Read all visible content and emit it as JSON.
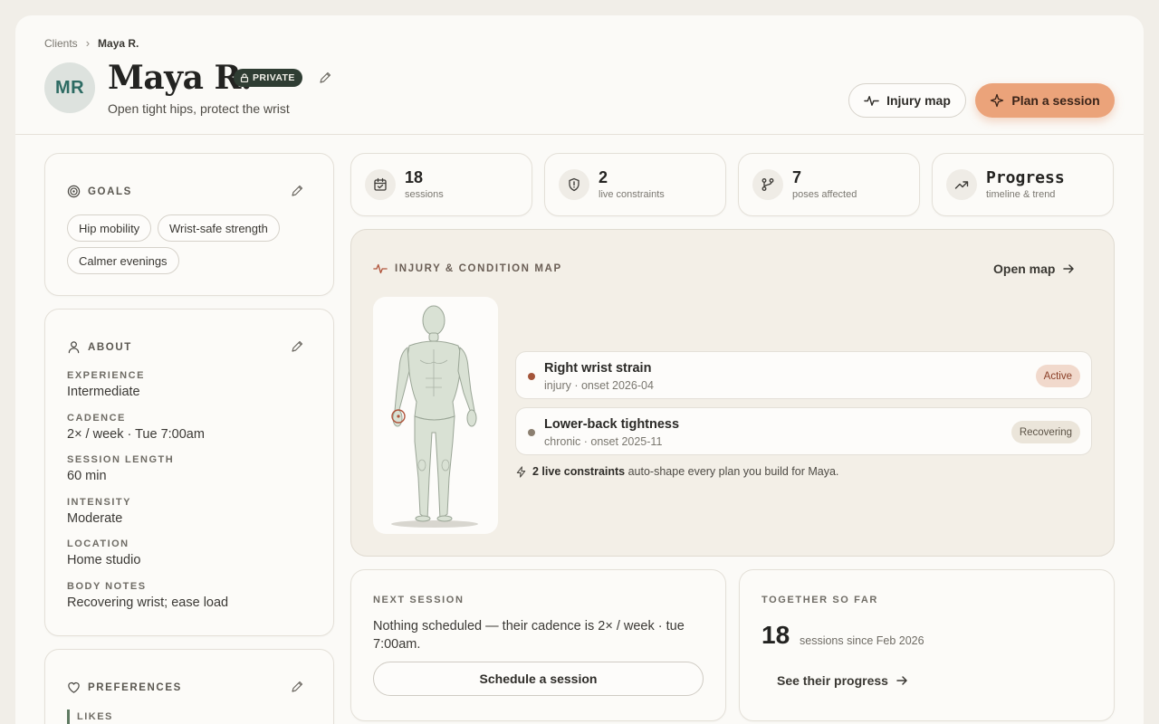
{
  "breadcrumb": {
    "root": "Clients",
    "current": "Maya R."
  },
  "client": {
    "initials": "MR",
    "name": "Maya R.",
    "privacy": "PRIVATE",
    "tagline": "Open tight hips, protect the wrist"
  },
  "header_actions": {
    "injury_map": "Injury map",
    "plan_session": "Plan a session"
  },
  "goals": {
    "title": "GOALS",
    "chips": [
      "Hip mobility",
      "Wrist-safe strength",
      "Calmer evenings"
    ]
  },
  "about": {
    "title": "ABOUT",
    "fields": [
      {
        "label": "EXPERIENCE",
        "value": "Intermediate"
      },
      {
        "label": "CADENCE",
        "value": "2× / week · Tue 7:00am"
      },
      {
        "label": "SESSION LENGTH",
        "value": "60 min"
      },
      {
        "label": "INTENSITY",
        "value": "Moderate"
      },
      {
        "label": "LOCATION",
        "value": "Home studio"
      },
      {
        "label": "BODY NOTES",
        "value": "Recovering wrist; ease load"
      }
    ]
  },
  "preferences": {
    "title": "PREFERENCES",
    "likes_label": "LIKES"
  },
  "stats": [
    {
      "num": "18",
      "label": "sessions",
      "icon": "calendar-icon"
    },
    {
      "num": "2",
      "label": "live constraints",
      "icon": "shield-icon"
    },
    {
      "num": "7",
      "label": "poses affected",
      "icon": "branch-icon"
    },
    {
      "num": "Progress",
      "label": "timeline & trend",
      "icon": "trend-icon"
    }
  ],
  "injury_map": {
    "title": "INJURY & CONDITION MAP",
    "open_link": "Open map",
    "conditions": [
      {
        "name": "Right wrist strain",
        "meta": "injury · onset 2026-04",
        "status": "Active",
        "dot_color": "#a4553a",
        "pill_bg": "#f1d9cc",
        "pill_fg": "#8a3f27"
      },
      {
        "name": "Lower-back tightness",
        "meta": "chronic · onset 2025-11",
        "status": "Recovering",
        "dot_color": "#8b7f70",
        "pill_bg": "#ebe5da",
        "pill_fg": "#5c5346"
      }
    ],
    "note_bold": "2 live constraints",
    "note_rest": " auto-shape every plan you build for Maya."
  },
  "next_session": {
    "title": "NEXT SESSION",
    "text": "Nothing scheduled — their cadence is 2× / week · tue 7:00am.",
    "button": "Schedule a session"
  },
  "together": {
    "title": "TOGETHER SO FAR",
    "count": "18",
    "since": "sessions since Feb 2026",
    "link": "See their progress"
  }
}
